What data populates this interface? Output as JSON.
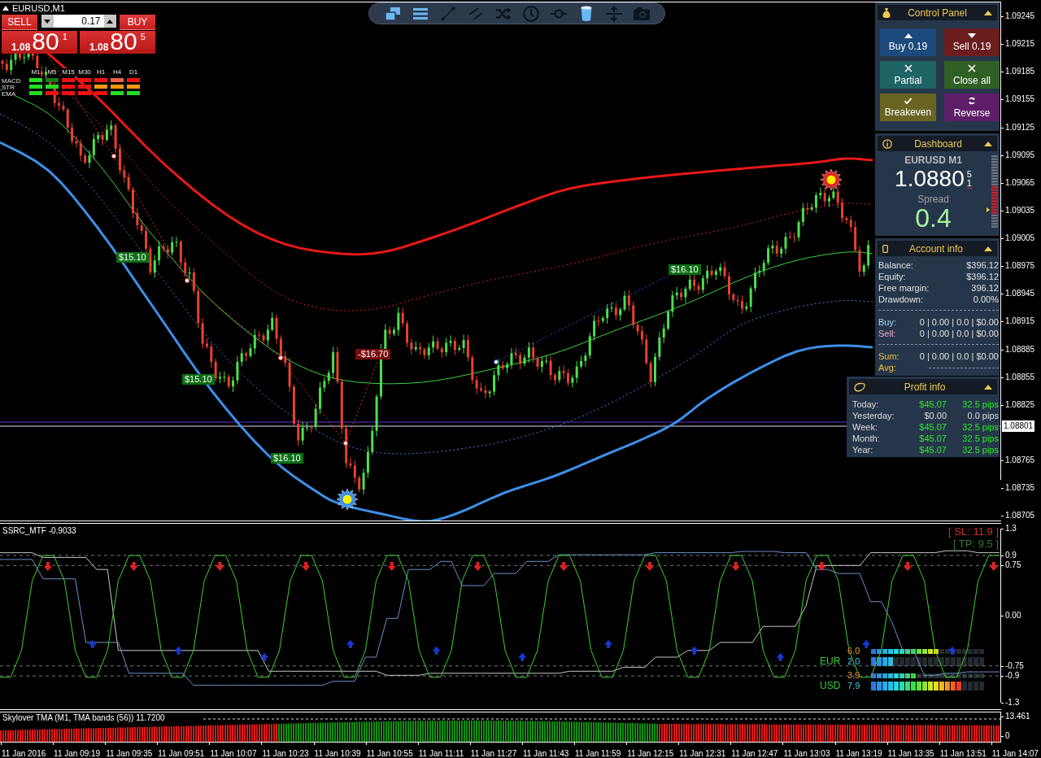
{
  "price_chart": {
    "title": "EURUSD,M1",
    "trade_labels": [
      {
        "text": "$15.10",
        "kind": "profit"
      },
      {
        "text": "$16.10",
        "kind": "profit"
      },
      {
        "text": "-$16.70",
        "kind": "loss"
      },
      {
        "text": "$15.10",
        "kind": "profit"
      },
      {
        "text": "$16.10",
        "kind": "profit"
      }
    ],
    "price_axis": [
      "1.09245",
      "1.09215",
      "1.09185",
      "1.09155",
      "1.09125",
      "1.09095",
      "1.09065",
      "1.09035",
      "1.09005",
      "1.08975",
      "1.08945",
      "1.08915",
      "1.08885",
      "1.08855",
      "1.08825",
      "1.08765",
      "1.08735",
      "1.08705"
    ],
    "current_price": "1.08801"
  },
  "trade_panel": {
    "sell": "SELL",
    "buy": "BUY",
    "lot": "0.17",
    "bid": {
      "prefix": "1.08",
      "pips": "80",
      "point": "1"
    },
    "ask": {
      "prefix": "1.08",
      "pips": "80",
      "point": "5"
    }
  },
  "mtf_table": {
    "timeframes": [
      "M1",
      "M5",
      "M15",
      "M30",
      "H1",
      "H4",
      "D1"
    ],
    "rows": [
      {
        "label": "MACD",
        "cells": [
          {
            "color": "#22dd22"
          },
          {
            "color": "#1a7a1a"
          },
          {
            "color": "#ee1111"
          },
          {
            "color": "#ee1111"
          },
          {
            "color": "#ee1111"
          },
          {
            "color": "#f0604a"
          },
          {
            "color": "#ee1111"
          }
        ]
      },
      {
        "label": "STR",
        "cells": [
          {
            "color": "#22dd22"
          },
          {
            "color": "#22dd22"
          },
          {
            "color": "#ee1111"
          },
          {
            "color": "#ee1111"
          },
          {
            "color": "#f59a0a"
          },
          {
            "color": "#f59a0a"
          },
          {
            "color": "#f59a0a"
          }
        ]
      },
      {
        "label": "EMA",
        "cells": [
          {
            "color": "#22dd22"
          },
          {
            "color": "#ee1111"
          },
          {
            "color": "#ee1111"
          },
          {
            "color": "#ee1111"
          },
          {
            "color": "#ee1111"
          },
          {
            "color": "#22dd22"
          },
          {
            "color": "#22dd22"
          }
        ]
      }
    ]
  },
  "toolbar": {
    "tools": [
      {
        "kind": "windows",
        "active": true
      },
      {
        "kind": "menu",
        "active": true
      },
      {
        "kind": "line",
        "active": false
      },
      {
        "kind": "channel",
        "active": false
      },
      {
        "kind": "shuffle",
        "active": false
      },
      {
        "kind": "clock",
        "active": false
      },
      {
        "kind": "ring",
        "active": false
      },
      {
        "kind": "bin",
        "active": true
      },
      {
        "kind": "resize",
        "active": false
      },
      {
        "kind": "camera",
        "active": false
      }
    ]
  },
  "control_panel": {
    "title": "Control Panel",
    "buttons": [
      {
        "kind": "buy",
        "label": "Buy 0.19"
      },
      {
        "kind": "sell",
        "label": "Sell 0.19"
      },
      {
        "kind": "partial",
        "label": "Partial"
      },
      {
        "kind": "closeall",
        "label": "Close all"
      },
      {
        "kind": "breakeven",
        "label": "Breakeven"
      },
      {
        "kind": "reverse",
        "label": "Reverse"
      }
    ]
  },
  "dashboard": {
    "title": "Dashboard",
    "symbol": "EURUSD M1",
    "price": "1.0880",
    "price_digits": [
      "5",
      "1"
    ],
    "spread_label": "Spread",
    "spread": "0.4"
  },
  "account_info": {
    "title": "Account info",
    "rows": [
      {
        "label": "Balance:",
        "value": "$396.12"
      },
      {
        "label": "Equity:",
        "value": "$396.12"
      },
      {
        "label": "Free margin:",
        "value": "396.12"
      },
      {
        "label": "Drawdown:",
        "value": "0.00%"
      }
    ],
    "trades": [
      {
        "kind": "buy",
        "label": "Buy:",
        "value": "0 | 0.00 | 0.0 | $0.00"
      },
      {
        "kind": "sell",
        "label": "Sell:",
        "value": "0 | 0.00 | 0.0 | $0.00"
      }
    ],
    "totals": [
      {
        "kind": "sum",
        "label": "Sum:",
        "value": "0 | 0.00 | 0.0 | $0.00"
      },
      {
        "kind": "avg",
        "label": "Avg:"
      }
    ]
  },
  "profit_info": {
    "title": "Profit info",
    "rows": [
      {
        "label": "Today:",
        "amount": "$45.07",
        "pips": "32.5 pips",
        "positive": true
      },
      {
        "label": "Yesterday:",
        "amount": "$0.00",
        "pips": "0.0 pips",
        "positive": false
      },
      {
        "label": "Week:",
        "amount": "$45.07",
        "pips": "32.5 pips",
        "positive": true
      },
      {
        "label": "Month:",
        "amount": "$45.07",
        "pips": "32.5 pips",
        "positive": true
      },
      {
        "label": "Year:",
        "amount": "$45.07",
        "pips": "32.5 pips",
        "positive": true
      }
    ]
  },
  "oscillator": {
    "chart_data": {
      "type": "line",
      "title": "SSRC_MTF -0.9033",
      "ylim": [
        -1.3,
        1.3
      ],
      "grid": true,
      "yticks": [
        {
          "value": 1.3,
          "label": "1.3"
        },
        {
          "value": 0.9,
          "label": "0.9"
        },
        {
          "value": 0.75,
          "label": "0.75"
        },
        {
          "value": 0,
          "label": "0.00"
        },
        {
          "value": -0.75,
          "label": "-0.75"
        },
        {
          "value": -0.9,
          "label": "-0.9"
        },
        {
          "value": -1.3,
          "label": "-1.3"
        }
      ],
      "series": [
        {
          "color": "#40d030",
          "values": [
            -0.92,
            -0.92,
            -0.52,
            0.52,
            0.9,
            0.9,
            0.52,
            -0.52,
            -0.92,
            -0.92,
            -0.52,
            0.52,
            0.9,
            0.9,
            0.52,
            -0.52,
            -0.92,
            -0.92,
            -0.52,
            0.52,
            0.9,
            0.9,
            0.52,
            -0.52,
            -0.92,
            -0.92,
            -0.52,
            0.52,
            0.9,
            0.9,
            0.52,
            -0.52,
            -0.92,
            -0.92,
            -0.52,
            0.52,
            0.9,
            0.9,
            0.52,
            -0.52,
            -0.92,
            -0.92,
            -0.52,
            0.52,
            0.9,
            0.9,
            0.52,
            -0.52,
            -0.92,
            -0.92,
            -0.52,
            0.52,
            0.9,
            0.9,
            0.52,
            -0.52,
            -0.92,
            -0.92,
            -0.52,
            0.52,
            0.9,
            0.9,
            0.52,
            -0.52,
            -0.92,
            -0.92,
            -0.52,
            0.52,
            0.9,
            0.9,
            0.52,
            -0.52,
            -0.92,
            -0.92,
            -0.52,
            0.52,
            0.9,
            0.9,
            0.52,
            -0.52,
            -0.92,
            -0.92,
            -0.52,
            0.52,
            0.9,
            0.9,
            0.52,
            -0.52,
            -0.92,
            -0.92,
            -0.52,
            0.52,
            0.9,
            0.9
          ]
        },
        {
          "color": "#7090c8",
          "values": [
            0.84,
            0.84,
            0.84,
            0.84,
            0.55,
            0.55,
            0.55,
            0.55,
            -0.4,
            -0.4,
            -0.4,
            -0.4,
            -0.86,
            -0.86,
            -0.86,
            -0.86,
            -0.86,
            -0.86,
            -1.04,
            -1.04,
            -1.04,
            -1.04,
            -1.04,
            -1.04,
            -1.04,
            -1.04,
            -1.04,
            -1.04,
            -1.04,
            -1.04,
            -1.04,
            -0.98,
            -0.98,
            -0.98,
            -0.62,
            -0.62,
            -0.04,
            -0.04,
            0.69,
            0.69,
            0.69,
            0.81,
            0.81,
            0.45,
            0.45,
            0.45,
            0.63,
            0.63,
            0.63,
            0.81,
            0.81,
            0.81,
            0.91,
            0.91,
            0.91,
            0.91,
            0.91,
            0.91,
            0.91,
            0.91,
            0.91,
            0.94,
            0.94,
            0.94,
            0.94,
            0.94,
            0.94,
            0.94,
            0.94,
            0.96,
            0.96,
            0.96,
            0.96,
            0.94,
            0.94,
            0.94,
            0.69,
            0.69,
            0.63,
            0.63,
            0.63,
            0.21,
            0.21,
            -0.1,
            -0.52,
            -0.52,
            -0.89,
            -0.89,
            -0.86,
            -0.86,
            -0.84,
            -0.84,
            -0.84,
            -0.84
          ]
        },
        {
          "color": "#c8c8c8",
          "values": [
            0.94,
            0.94,
            0.94,
            0.94,
            0.87,
            0.87,
            0.87,
            0.87,
            0.87,
            0.69,
            0.69,
            -0.52,
            -0.52,
            -0.52,
            -0.52,
            -0.52,
            -0.52,
            -0.52,
            -0.52,
            -0.52,
            -0.52,
            -0.52,
            -0.52,
            -0.52,
            -0.52,
            -0.83,
            -0.83,
            -0.83,
            -0.83,
            -0.83,
            -0.83,
            -0.83,
            -0.83,
            -0.83,
            -0.83,
            -0.83,
            -0.89,
            -0.89,
            -0.89,
            -0.89,
            -0.86,
            -0.86,
            -0.86,
            -0.86,
            -0.86,
            -0.86,
            -0.86,
            -0.86,
            -0.86,
            -0.86,
            -0.86,
            -0.86,
            -0.86,
            -0.83,
            -0.83,
            -0.83,
            -0.83,
            -0.83,
            -0.77,
            -0.77,
            -0.77,
            -0.62,
            -0.62,
            -0.62,
            -0.52,
            -0.52,
            -0.52,
            -0.4,
            -0.4,
            -0.4,
            -0.4,
            -0.16,
            -0.16,
            -0.16,
            -0.16,
            0.15,
            0.75,
            0.75,
            0.75,
            0.75,
            0.75,
            0.94,
            0.94,
            0.94,
            0.94,
            0.94,
            0.94,
            0.94,
            0.97,
            0.97,
            0.97,
            0.94,
            0.94,
            0.94
          ]
        }
      ]
    },
    "stop_loss": "[ SL: 11.9 ]",
    "take_profit": "[ TP: 9.5 ]",
    "strength": [
      {
        "currency": "EUR",
        "meters": [
          {
            "kind": "thin",
            "value": "6.0",
            "level": 0.6
          },
          {
            "kind": "thick",
            "value": "2.0",
            "level": 0.2
          }
        ]
      },
      {
        "currency": "USD",
        "meters": [
          {
            "kind": "thin",
            "value": "3.9",
            "level": 0.39
          },
          {
            "kind": "thick",
            "value": "7.9",
            "level": 0.79
          }
        ]
      }
    ]
  },
  "histogram": {
    "title": "Skylover TMA (M1, TMA bands (56)) 11.7200",
    "axis": [
      "13.461",
      "0"
    ]
  },
  "time_axis": [
    "11 Jan 2016",
    "11 Jan 09:19",
    "11 Jan 09:35",
    "11 Jan 09:51",
    "11 Jan 10:07",
    "11 Jan 10:23",
    "11 Jan 10:39",
    "11 Jan 10:55",
    "11 Jan 11:11",
    "11 Jan 11:27",
    "11 Jan 11:43",
    "11 Jan 11:59",
    "11 Jan 12:15",
    "11 Jan 12:31",
    "11 Jan 12:47",
    "11 Jan 13:03",
    "11 Jan 13:19",
    "11 Jan 13:35",
    "11 Jan 13:51",
    "11 Jan 14:07"
  ]
}
